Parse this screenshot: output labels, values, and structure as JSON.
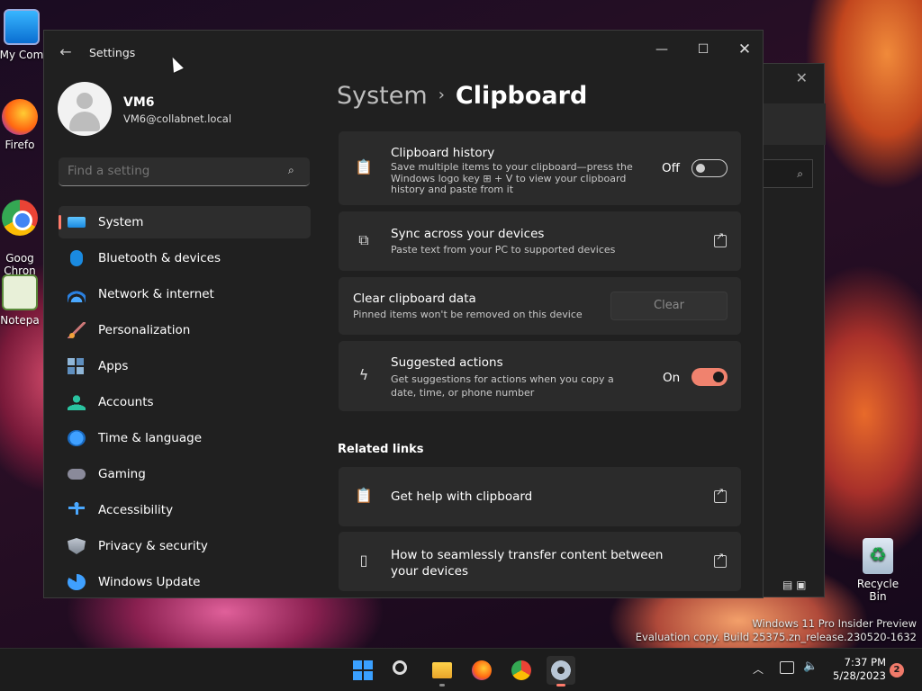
{
  "desktop": {
    "icons": [
      {
        "label": "My Com",
        "icon": "computer-icon"
      },
      {
        "label": "Firefo",
        "icon": "firefox-icon"
      },
      {
        "label": "Goog\nChron",
        "icon": "chrome-icon"
      },
      {
        "label": "Notepa",
        "icon": "notepad-icon"
      },
      {
        "label": "Recycle Bin",
        "icon": "recycle-bin-icon"
      }
    ],
    "watermark": {
      "line1": "Windows 11 Pro Insider Preview",
      "line2": "Evaluation copy. Build 25375.zn_release.230520-1632"
    }
  },
  "window": {
    "title": "Settings",
    "controls": {
      "minimize": "—",
      "maximize": "☐",
      "close": "✕"
    }
  },
  "profile": {
    "name": "VM6",
    "email": "VM6@collabnet.local"
  },
  "search": {
    "placeholder": "Find a setting"
  },
  "nav": {
    "items": [
      {
        "label": "System",
        "icon": "system-icon",
        "active": true
      },
      {
        "label": "Bluetooth & devices",
        "icon": "bluetooth-icon"
      },
      {
        "label": "Network & internet",
        "icon": "network-icon"
      },
      {
        "label": "Personalization",
        "icon": "brush-icon"
      },
      {
        "label": "Apps",
        "icon": "apps-icon"
      },
      {
        "label": "Accounts",
        "icon": "account-icon"
      },
      {
        "label": "Time & language",
        "icon": "globe-clock-icon"
      },
      {
        "label": "Gaming",
        "icon": "gamepad-icon"
      },
      {
        "label": "Accessibility",
        "icon": "accessibility-icon"
      },
      {
        "label": "Privacy & security",
        "icon": "shield-icon"
      },
      {
        "label": "Windows Update",
        "icon": "update-icon"
      }
    ]
  },
  "main": {
    "breadcrumb": {
      "parent": "System",
      "separator": "›",
      "current": "Clipboard"
    },
    "cards": {
      "history": {
        "title": "Clipboard history",
        "desc": "Save multiple items to your clipboard—press the Windows logo key ⊞ + V to view your clipboard history and paste from it",
        "state": "Off"
      },
      "sync": {
        "title": "Sync across your devices",
        "desc": "Paste text from your PC to supported devices"
      },
      "clear": {
        "title": "Clear clipboard data",
        "desc": "Pinned items won't be removed on this device",
        "button": "Clear"
      },
      "suggest": {
        "title": "Suggested actions",
        "desc": "Get suggestions for actions when you copy a date, time, or phone number",
        "state": "On"
      }
    },
    "related": {
      "heading": "Related links",
      "help": "Get help with clipboard",
      "transfer": "How to seamlessly transfer content between your devices"
    }
  },
  "taskbar": {
    "apps": [
      "start-icon",
      "search-icon",
      "file-explorer-icon",
      "firefox-icon",
      "chrome-icon",
      "settings-gear-icon"
    ],
    "clock": {
      "time": "7:37 PM",
      "date": "5/28/2023"
    },
    "notifications": "2"
  },
  "colors": {
    "accent": "#f0826e",
    "window_bg": "#202020",
    "card_bg": "#2b2b2b"
  }
}
